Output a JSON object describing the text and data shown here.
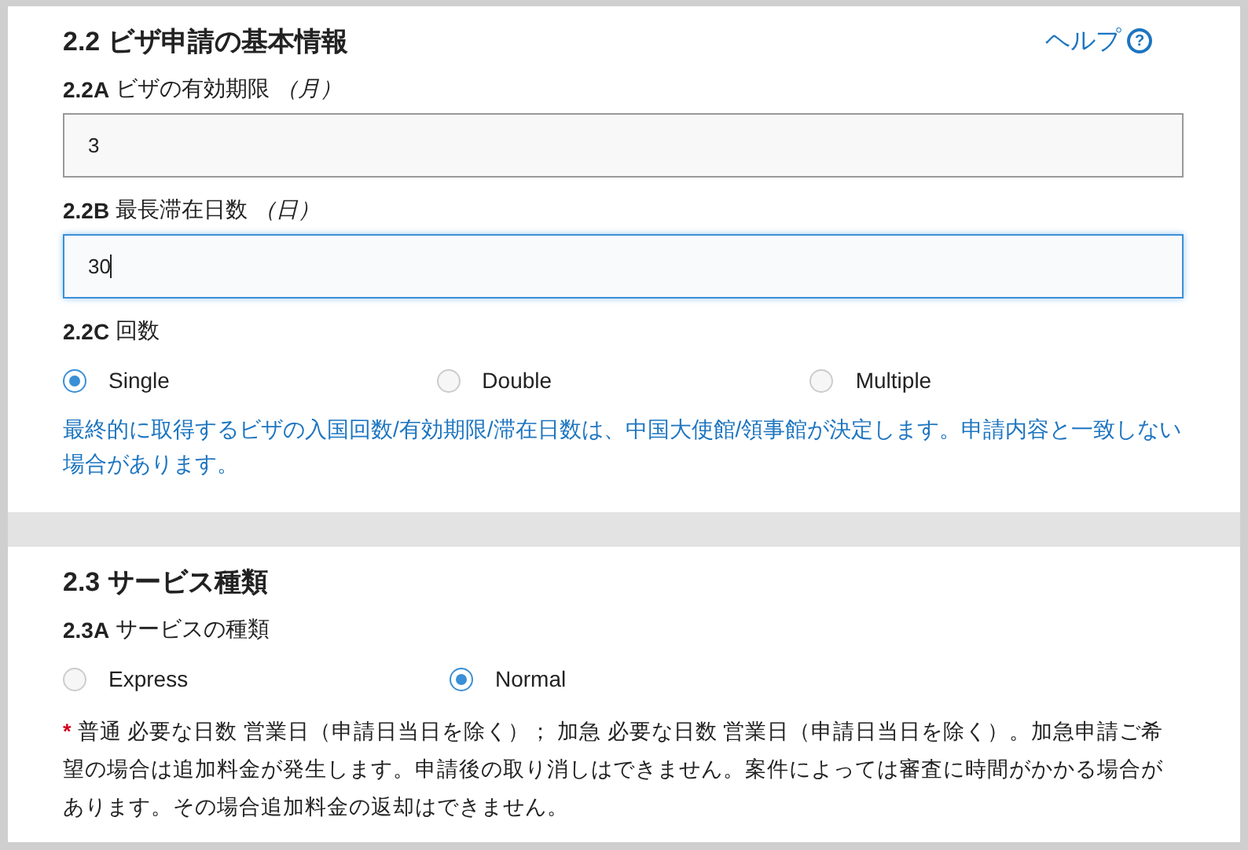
{
  "sections": [
    {
      "title": "2.2 ビザ申請の基本情報",
      "help": {
        "label": "ヘルプ",
        "icon": "?"
      },
      "fields": [
        {
          "kind": "input",
          "code": "2.2A",
          "label": "ビザの有効期限",
          "unit": "（月）",
          "value": "3",
          "focused": false
        },
        {
          "kind": "input",
          "code": "2.2B",
          "label": "最長滞在日数",
          "unit": "（日）",
          "value": "30",
          "focused": true
        },
        {
          "kind": "radio",
          "code": "2.2C",
          "label": "回数",
          "options": [
            {
              "label": "Single",
              "selected": true
            },
            {
              "label": "Double",
              "selected": false
            },
            {
              "label": "Multiple",
              "selected": false
            }
          ]
        }
      ],
      "note": {
        "kind": "info",
        "text": "最終的に取得するビザの入国回数/有効期限/滞在日数は、中国大使館/領事館が決定します。申請内容と一致しない場合があります。"
      }
    },
    {
      "title": "2.3 サービス種類",
      "fields": [
        {
          "kind": "radio",
          "code": "2.3A",
          "label": "サービスの種類",
          "options": [
            {
              "label": "Express",
              "selected": false
            },
            {
              "label": "Normal",
              "selected": true
            }
          ]
        }
      ],
      "note": {
        "kind": "required",
        "mark": "*",
        "text": "普通 必要な日数 営業日（申請日当日を除く）； 加急 必要な日数 営業日（申請日当日を除く）。加急申請ご希望の場合は追加料金が発生します。申請後の取り消しはできません。案件によっては審査に時間がかかる場合があります。その場合追加料金の返却はできません。"
      }
    }
  ]
}
